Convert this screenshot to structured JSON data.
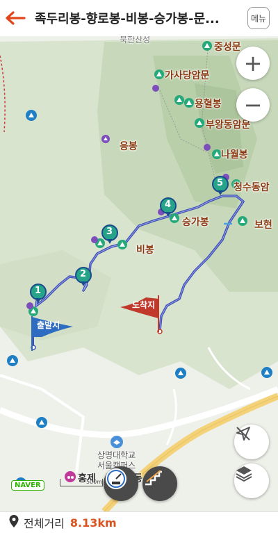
{
  "header": {
    "title": "족두리봉-향로봉-비봉-승가봉-문...",
    "menu_label": "메뉴"
  },
  "map": {
    "peaks": [
      "중성문",
      "가사당암문",
      "용혈봉",
      "부왕동암문",
      "나월봉",
      "응봉",
      "청수동암",
      "보현",
      "승가봉",
      "비봉"
    ],
    "place_top": "북한산성",
    "campus": "상명대학교\n서울캠퍼스",
    "poi_bottom": "홍제",
    "poi_bottom2": "동",
    "start_label": "출발지",
    "end_label": "도착지",
    "waypoints": [
      "1",
      "2",
      "3",
      "4",
      "5"
    ],
    "scale_text": "500m",
    "naver_logo": "NAVER",
    "route_color": "#3d4fb8",
    "start_flag_color": "#2d6cc0",
    "end_flag_color": "#c0392b"
  },
  "footer": {
    "label": "전체거리",
    "value": "8.13km"
  }
}
